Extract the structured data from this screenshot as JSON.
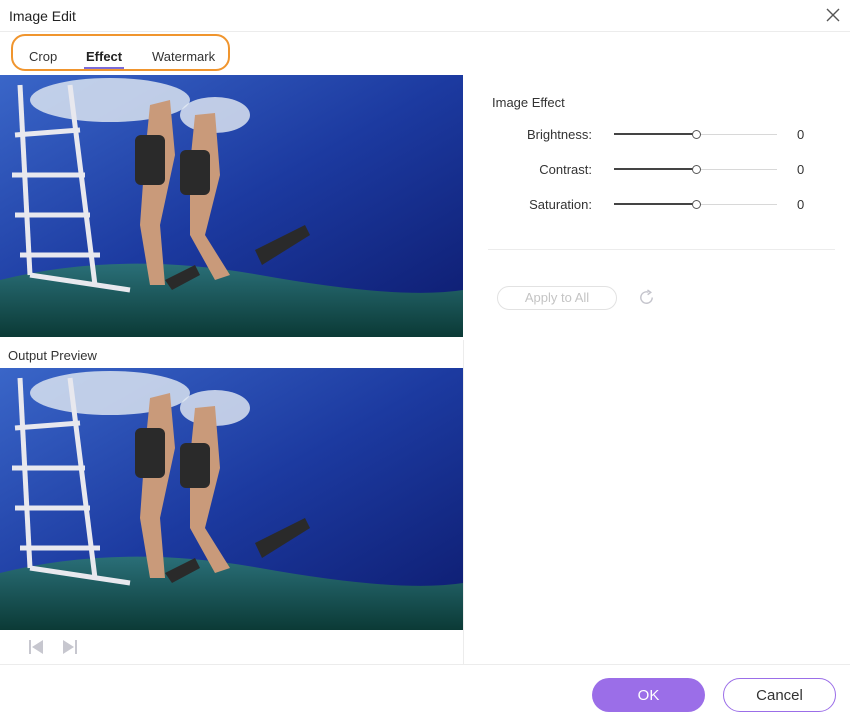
{
  "window": {
    "title": "Image Edit"
  },
  "tabs": [
    {
      "label": "Crop",
      "active": false
    },
    {
      "label": "Effect",
      "active": true
    },
    {
      "label": "Watermark",
      "active": false
    }
  ],
  "preview": {
    "label": "Output Preview"
  },
  "effect": {
    "section_title": "Image Effect",
    "sliders": [
      {
        "label": "Brightness:",
        "value": "0",
        "level": 0.5
      },
      {
        "label": "Contrast:",
        "value": "0",
        "level": 0.5
      },
      {
        "label": "Saturation:",
        "value": "0",
        "level": 0.5
      }
    ],
    "apply_all_label": "Apply to All"
  },
  "footer": {
    "ok_label": "OK",
    "cancel_label": "Cancel"
  },
  "colors": {
    "accent": "#9b6ee8",
    "tab_highlight": "#f0952e",
    "tab_underline": "#7b6bd6"
  },
  "icons": {
    "close": "close-icon",
    "prev": "skip-previous-icon",
    "next": "skip-next-icon",
    "reset": "reset-icon"
  }
}
